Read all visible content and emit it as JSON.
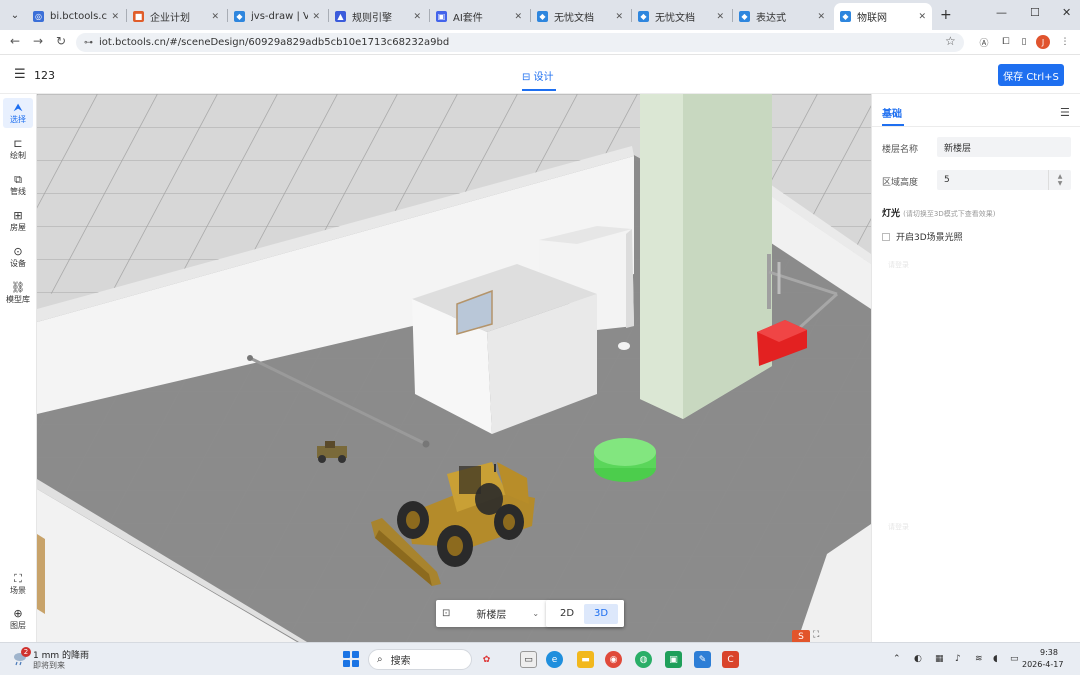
{
  "browser": {
    "tabs": [
      {
        "label": "bi.bctools.cn",
        "fav_color": "#3b6fd8",
        "fav_glyph": "◎"
      },
      {
        "label": "企业计划",
        "fav_color": "#e05d2a",
        "fav_glyph": "■"
      },
      {
        "label": "jvs-draw | Virtu",
        "fav_color": "#2e86de",
        "fav_glyph": "◆"
      },
      {
        "label": "规则引擎",
        "fav_color": "#3b5bdb",
        "fav_glyph": "▲"
      },
      {
        "label": "AI套件",
        "fav_color": "#4263eb",
        "fav_glyph": "▣"
      },
      {
        "label": "无忧文档",
        "fav_color": "#2e86de",
        "fav_glyph": "◆"
      },
      {
        "label": "无忧文档",
        "fav_color": "#2e86de",
        "fav_glyph": "◆"
      },
      {
        "label": "表达式",
        "fav_color": "#2e86de",
        "fav_glyph": "◆"
      },
      {
        "label": "物联网",
        "fav_color": "#2e86de",
        "fav_glyph": "◆"
      }
    ],
    "tab_close": "✕",
    "new_tab": "+",
    "url": "iot.bctools.cn/#/sceneDesign/60929a829adb5cb10e1713c68232a9bd",
    "profile_initial": "J"
  },
  "header": {
    "project_name": "123",
    "center_tab": "⊟ 设计",
    "save_button": "保存 Ctrl+S"
  },
  "left_tools": [
    {
      "icon": "⮝",
      "label": "选择",
      "name": "select"
    },
    {
      "icon": "⊏",
      "label": "绘制",
      "name": "draw"
    },
    {
      "icon": "⧉",
      "label": "管线",
      "name": "pipeline"
    },
    {
      "icon": "⊞",
      "label": "房屋",
      "name": "house"
    },
    {
      "icon": "⊙",
      "label": "设备",
      "name": "device"
    },
    {
      "icon": "⛓",
      "label": "模型库",
      "name": "model-library"
    }
  ],
  "left_bottom_tools": [
    {
      "icon": "⛶",
      "label": "场景",
      "name": "scene"
    },
    {
      "icon": "⊕",
      "label": "图层",
      "name": "layer"
    }
  ],
  "viewport": {
    "layer_select": "新楼层",
    "mode_2d": "2D",
    "mode_3d": "3D",
    "active_mode": "3D",
    "corner_badge": "S"
  },
  "right_panel": {
    "tab": "基础",
    "floor_name_label": "楼层名称",
    "floor_name_value": "新楼层",
    "area_height_label": "区域高度",
    "area_height_value": "5",
    "light_section": "灯光",
    "light_hint": "(请切换至3D模式下查看效果)",
    "light_checkbox_label": "开启3D场景光照",
    "light_checked": false,
    "watermark": "请登录"
  },
  "taskbar": {
    "weather_badge": "2",
    "weather_line1": "1 mm 的降雨",
    "weather_line2": "即将到来",
    "search_label": "搜索",
    "time": "9:38",
    "date": "2026-4-17"
  }
}
